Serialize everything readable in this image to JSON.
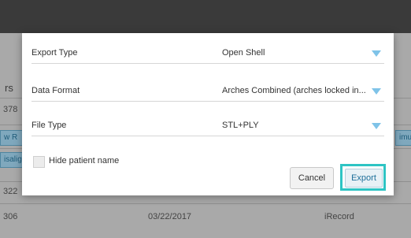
{
  "background": {
    "column_header_fragment": "rs",
    "rows": [
      {
        "id_fragment": "378"
      },
      {
        "tag_left": "w R",
        "tag_right": "imu"
      },
      {
        "tag_left": "isalig"
      },
      {
        "id_fragment": "322"
      },
      {
        "id_fragment": "306",
        "date": "03/22/2017",
        "source": "iRecord"
      }
    ]
  },
  "dialog": {
    "fields": [
      {
        "label": "Export Type",
        "value": "Open Shell"
      },
      {
        "label": "Data Format",
        "value": "Arches Combined (arches locked in..."
      },
      {
        "label": "File Type",
        "value": "STL+PLY"
      }
    ],
    "hide_patient_name_label": "Hide patient name",
    "hide_patient_name_checked": false,
    "cancel_label": "Cancel",
    "export_label": "Export"
  },
  "colors": {
    "accent_caret": "#7fc3e8",
    "export_highlight": "#2ec4c4"
  }
}
